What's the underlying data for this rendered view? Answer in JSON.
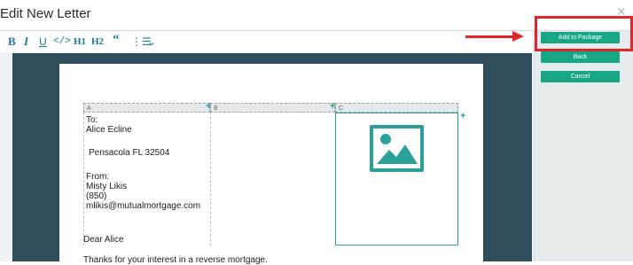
{
  "dialog": {
    "title": "Edit New Letter",
    "close_glyph": "×"
  },
  "toolbar": {
    "bold": "B",
    "italic": "I",
    "underline": "U",
    "code": "</>",
    "h1": "H1",
    "h2": "H2",
    "quote": "“",
    "list": "⋮☰",
    "list_caret": "⌄"
  },
  "table": {
    "col_a": "A",
    "col_b": "B",
    "col_c": "C",
    "add_glyph": "+"
  },
  "letter": {
    "to_label": "To:",
    "to_name": "Alice Ecline",
    "to_city": "Pensacola FL 32504",
    "from_label": "From:",
    "from_name": "Misty Likis",
    "from_phone": "(850)",
    "from_email": "mlikis@mutualmortgage.com",
    "greeting": "Dear Alice",
    "body_line": "Thanks for your interest in a reverse mortgage."
  },
  "actions": {
    "add_to_package": "Add to Package",
    "back": "Back",
    "cancel": "Cancel"
  },
  "colors": {
    "accent": "#18a785",
    "annotation": "#e0262b",
    "editor_bg": "#2f4d5c"
  },
  "icons": {
    "image": "image-placeholder-icon"
  }
}
